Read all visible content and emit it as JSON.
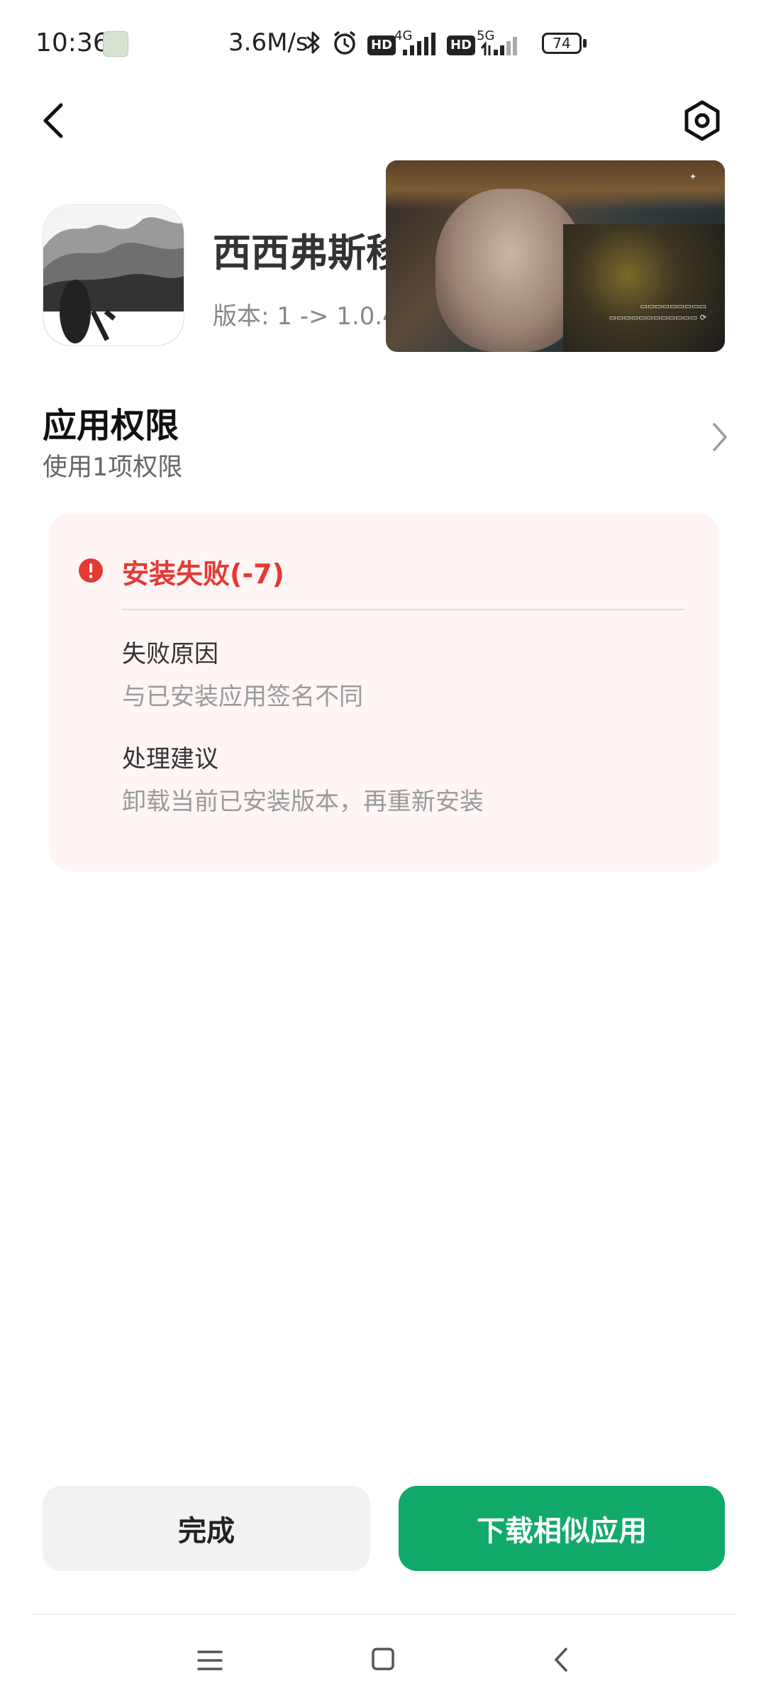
{
  "status_bar": {
    "time": "10:36",
    "speed": "3.6M/s",
    "sim1_badge": "HD",
    "sim1_network": "4G",
    "sim2_badge": "HD",
    "sim2_network": "5G",
    "battery": "74"
  },
  "app": {
    "name": "西西弗斯移",
    "version": "版本: 1 -> 1.0.4"
  },
  "permissions": {
    "title": "应用权限",
    "subtitle": "使用1项权限"
  },
  "error": {
    "title": "安装失败(-7)",
    "reason_label": "失败原因",
    "reason_text": "与已安装应用签名不同",
    "advice_label": "处理建议",
    "advice_text": "卸载当前已安装版本，再重新安装"
  },
  "buttons": {
    "done": "完成",
    "download_similar": "下载相似应用"
  },
  "colors": {
    "error": "#e53935",
    "primary_green": "#11aa6a",
    "card_bg": "#fff5f5"
  },
  "icons": {
    "back": "chevron-left-icon",
    "settings": "hexagon-settings-icon",
    "bluetooth": "bluetooth-icon",
    "alarm": "alarm-clock-icon",
    "permission_more": "chevron-right-icon",
    "error": "exclamation-circle-icon",
    "nav_menu": "menu-lines-icon",
    "nav_home": "square-home-icon",
    "nav_back": "triangle-back-icon"
  }
}
